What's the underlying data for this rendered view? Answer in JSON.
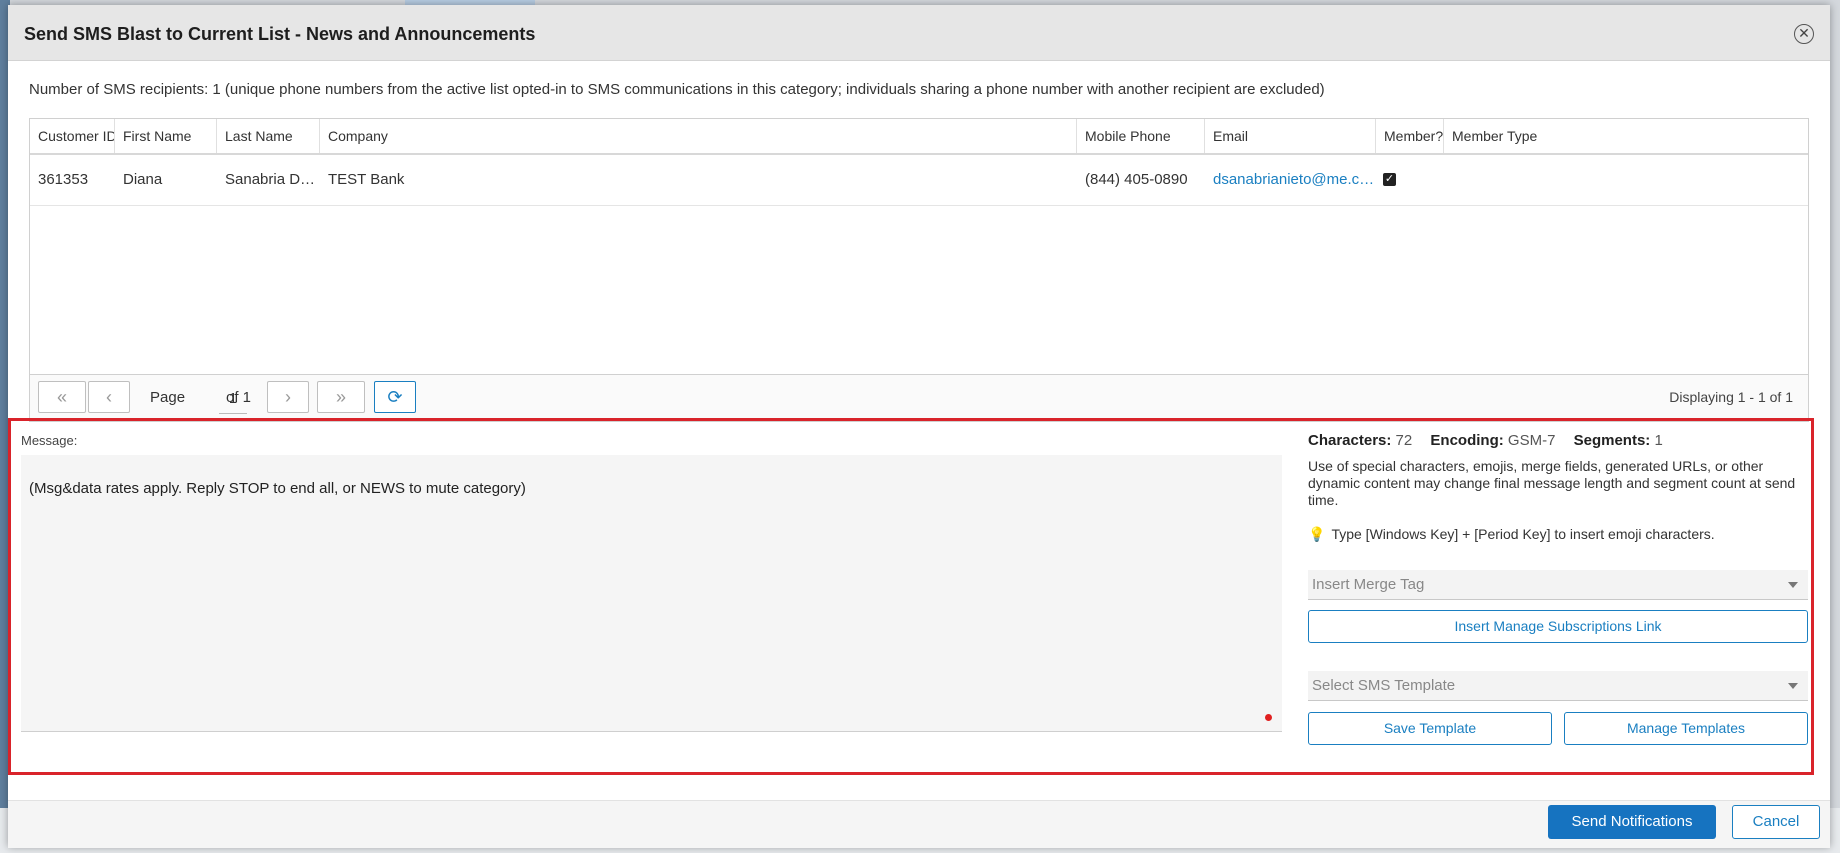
{
  "dialog": {
    "title": "Send SMS Blast to Current List - News and Announcements",
    "close_icon": "close-icon"
  },
  "recipients_info": "Number of SMS recipients: 1 (unique phone numbers from the active list opted-in to SMS communications in this category; individuals sharing a phone number with another recipient are excluded)",
  "grid": {
    "columns": [
      "Customer ID",
      "First Name",
      "Last Name",
      "Company",
      "Mobile Phone",
      "Email",
      "Member?",
      "Member Type"
    ],
    "rows": [
      {
        "customer_id": "361353",
        "first_name": "Diana",
        "last_name": "Sanabria Don'...",
        "company": "TEST Bank",
        "mobile_phone": "(844) 405-0890",
        "email": "dsanabrianieto@me.com",
        "member": true,
        "member_type": ""
      }
    ]
  },
  "pager": {
    "page_label": "Page",
    "page_value": "1",
    "of_label": "of 1",
    "displaying": "Displaying 1 - 1 of 1"
  },
  "message": {
    "label": "Message:",
    "text": "(Msg&data rates apply. Reply STOP to end all, or NEWS to mute category)"
  },
  "stats": {
    "characters_label": "Characters:",
    "characters_value": "72",
    "encoding_label": "Encoding:",
    "encoding_value": "GSM-7",
    "segments_label": "Segments:",
    "segments_value": "1"
  },
  "note": "Use of special characters, emojis, merge fields, generated URLs, or other dynamic content may change final message length and segment count at send time.",
  "tip": "Type [Windows Key] + [Period Key] to insert emoji characters.",
  "merge_tag_placeholder": "Insert Merge Tag",
  "insert_link_label": "Insert Manage Subscriptions Link",
  "template_placeholder": "Select SMS Template",
  "save_template_label": "Save Template",
  "manage_templates_label": "Manage Templates",
  "footer": {
    "send_label": "Send Notifications",
    "cancel_label": "Cancel"
  },
  "colors": {
    "accent": "#1a7fc1",
    "highlight": "#d9232a",
    "primary_button": "#1673c0"
  }
}
